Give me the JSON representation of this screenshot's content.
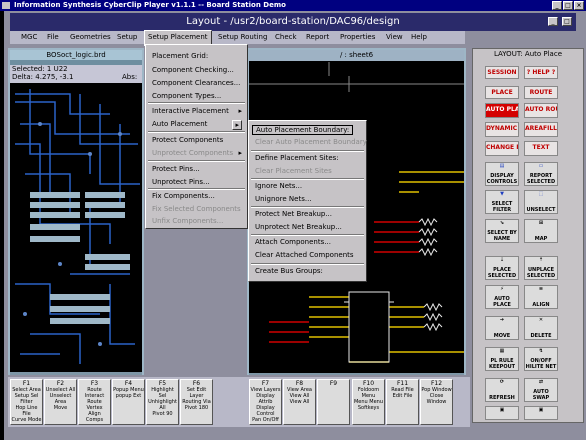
{
  "window_title": "Information Synthesis CyberClip Player v1.1.1 -- Board Station Demo",
  "layout_title": "Layout - /usr2/board-station/DAC96/design",
  "menubar": [
    "MGC",
    "File",
    "Geometries",
    "Setup",
    "Setup Placement",
    "Setup Routing",
    "Check",
    "Report",
    "Properties",
    "View",
    "Help"
  ],
  "pcb_window": {
    "title": "BOSoct_logic.brd",
    "selected": "Selected: 1 U22",
    "delta": "Delta:  4.275, -3.1",
    "abs": "Abs:"
  },
  "schematic_window": {
    "title": "/ : sheet6"
  },
  "setup_placement_menu": {
    "items": [
      {
        "label": "Placement Grid:",
        "disabled": false,
        "arrow": false
      },
      {
        "label": "Component Checking...",
        "disabled": false,
        "arrow": false
      },
      {
        "label": "Component Clearances...",
        "disabled": false,
        "arrow": false
      },
      {
        "label": "Component Types...",
        "disabled": false,
        "arrow": false
      },
      {
        "label": "Interactive Placement",
        "disabled": false,
        "arrow": true
      },
      {
        "label": "Auto Placement",
        "disabled": false,
        "arrow": true
      },
      {
        "label": "Protect Components",
        "disabled": false,
        "arrow": false
      },
      {
        "label": "Unprotect Components",
        "disabled": true,
        "arrow": true
      },
      {
        "label": "Protect Pins...",
        "disabled": false,
        "arrow": false
      },
      {
        "label": "Unprotect Pins...",
        "disabled": false,
        "arrow": false
      },
      {
        "label": "Fix Components...",
        "disabled": false,
        "arrow": false
      },
      {
        "label": "Fix Selected Components",
        "disabled": true,
        "arrow": false
      },
      {
        "label": "Unfix Components...",
        "disabled": true,
        "arrow": false
      }
    ]
  },
  "auto_placement_submenu": {
    "items": [
      {
        "label": "Auto Placement Boundary:",
        "disabled": false
      },
      {
        "label": "Clear Auto Placement Boundary",
        "disabled": true
      },
      {
        "label": "Define Placement Sites:",
        "disabled": false
      },
      {
        "label": "Clear Placement Sites",
        "disabled": true
      },
      {
        "label": "Ignore Nets...",
        "disabled": false
      },
      {
        "label": "Unignore Nets...",
        "disabled": false
      },
      {
        "label": "Protect Net Breakup...",
        "disabled": false
      },
      {
        "label": "Unprotect Net Breakup...",
        "disabled": false
      },
      {
        "label": "Attach Components...",
        "disabled": false
      },
      {
        "label": "Clear Attached Components",
        "disabled": false
      },
      {
        "label": "Create Bus Groups:",
        "disabled": false
      }
    ]
  },
  "palette": {
    "header": "LAYOUT: Auto Place",
    "text_buttons": [
      [
        "SESSION",
        "? HELP ?"
      ],
      [
        "PLACE",
        "ROUTE"
      ],
      [
        "AUTO PLACE",
        "AUTO ROUTE"
      ],
      [
        "DYNAMIC CTRLS",
        "AREAFILL"
      ],
      [
        "CHANGE REF",
        "TEXT"
      ]
    ],
    "icon_buttons": [
      [
        "DISPLAY CONTROLS",
        "REPORT SELECTED"
      ],
      [
        "SELECT FILTER",
        "UNSELECT"
      ],
      [
        "SELECT BY NAME",
        "MAP"
      ],
      [
        "PLACE SELECTED",
        "UNPLACE SELECTED"
      ],
      [
        "AUTO PLACE",
        "ALIGN"
      ],
      [
        "MOVE",
        "DELETE"
      ],
      [
        "PL RULE KEEPOUT",
        "ON/OFF HILITE NET"
      ],
      [
        "REFRESH",
        "AUTO SWAP"
      ],
      [
        "",
        ""
      ]
    ]
  },
  "function_keys": [
    {
      "key": "F1",
      "lines": [
        "Select Area",
        "Setup Sel Filter",
        "Hop Line File",
        "Curve Mode"
      ]
    },
    {
      "key": "F2",
      "lines": [
        "Unselect All",
        "Unselect Area",
        "Move"
      ]
    },
    {
      "key": "F3",
      "lines": [
        "Route Interact",
        "Route Vertex",
        "Align Comps"
      ]
    },
    {
      "key": "F4",
      "lines": [
        "Popup Menu",
        "popup Ext"
      ]
    },
    {
      "key": "F5",
      "lines": [
        "Highlight Sel",
        "Unhighlight All",
        "Pivot 90"
      ]
    },
    {
      "key": "F6",
      "lines": [
        "Set Edit Layer",
        "Routing Via",
        "Pivot 180"
      ]
    },
    {
      "key": "F7",
      "lines": [
        "View Layers",
        "Display Attrib",
        "Display Control",
        "Pan On/Off"
      ]
    },
    {
      "key": "F8",
      "lines": [
        "View Area",
        "View All",
        "View All"
      ]
    },
    {
      "key": "F9",
      "lines": []
    },
    {
      "key": "F10",
      "lines": [
        "Foldoom Menu",
        "Menu Menu",
        "Softkeys"
      ]
    },
    {
      "key": "F11",
      "lines": [
        "Read File",
        "Edit File"
      ]
    },
    {
      "key": "F12",
      "lines": [
        "Pop Window",
        "Close Window"
      ]
    }
  ],
  "colors": {
    "title_blue": "#000080",
    "trace_blue": "#2060c0",
    "trace_yellow": "#e0c000",
    "trace_red": "#d00000",
    "palette_red": "#c00000"
  }
}
